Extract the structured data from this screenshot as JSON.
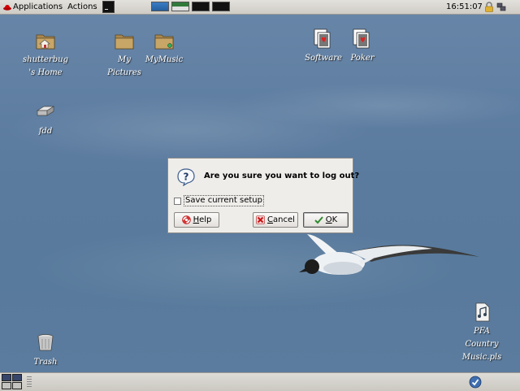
{
  "top_panel": {
    "applications_label": "Applications",
    "actions_label": "Actions",
    "clock": "16:51:07"
  },
  "desktop": {
    "icons": [
      {
        "label_line1": "shutterbug",
        "label_line2": "'s Home"
      },
      {
        "label_line1": "My",
        "label_line2": "Pictures"
      },
      {
        "label_line1": "MyMusic"
      },
      {
        "label_line1": "Software"
      },
      {
        "label_line1": "Poker"
      },
      {
        "label_line1": "fdd"
      },
      {
        "label_line1": "Trash"
      },
      {
        "label_line1": "PFA",
        "label_line2": "Country",
        "label_line3": "Music.pls"
      }
    ]
  },
  "dialog": {
    "message": "Are you sure you want to log out?",
    "save_setup_label": "Save current setup",
    "save_setup_checked": false,
    "help_label_mnemonic": "H",
    "help_label_rest": "elp",
    "cancel_label_mnemonic": "C",
    "cancel_label_rest": "ancel",
    "ok_label_mnemonic": "O",
    "ok_label_rest": "K"
  },
  "colors": {
    "desktop_blue": "#5f7fa2",
    "panel": "#d6d3ce",
    "dialog_bg": "#efedea",
    "redhat_red": "#cc0000"
  },
  "icons": {
    "menu": "redhat-icon",
    "launcher": "terminal-icon",
    "tray_1": "lock-icon",
    "tray_2": "network-icon",
    "dialog": "question-icon",
    "help": "help-lifebuoy-icon",
    "cancel": "cancel-x-icon",
    "ok": "ok-check-icon",
    "notify": "update-notifier-icon"
  }
}
